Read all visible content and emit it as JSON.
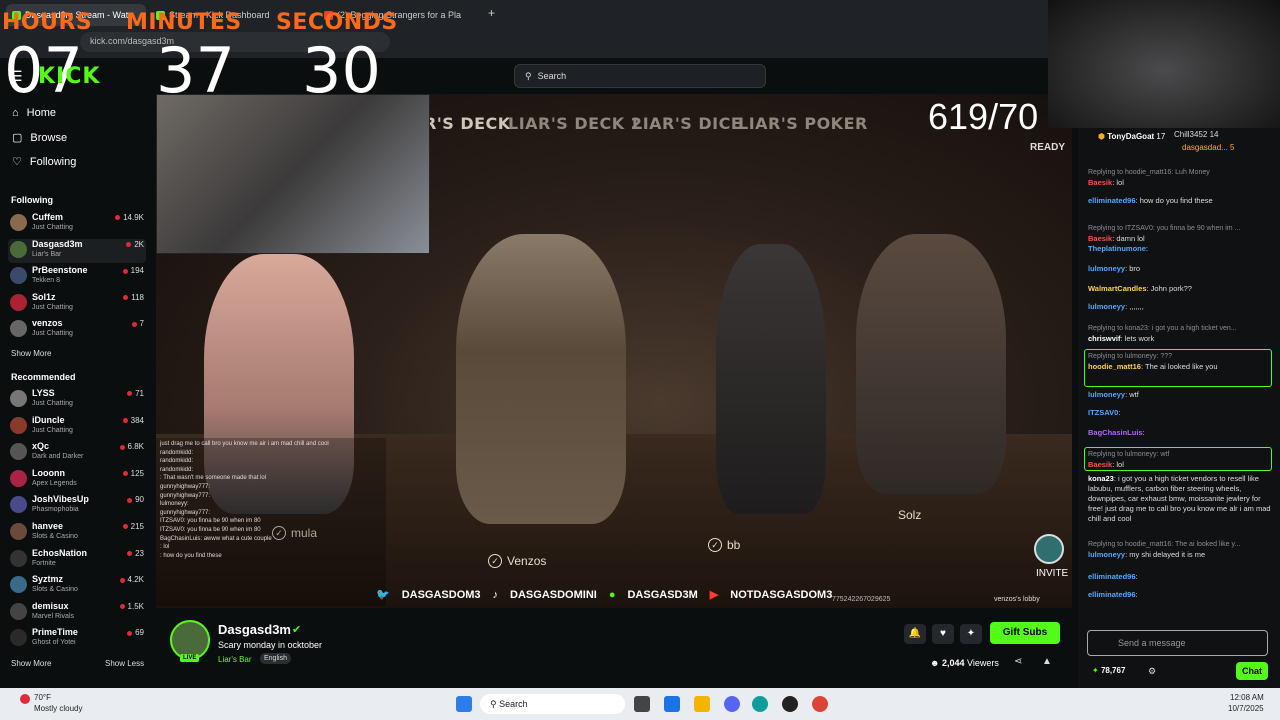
{
  "browser": {
    "tabs": [
      "Dasgasd3m Stream - Watc",
      "Stream - Kick Dashboard",
      "(2) Begging Strangers for a Pla"
    ],
    "url": "kick.com/dasgasd3m"
  },
  "timer": {
    "labels": [
      "HOURS",
      "MINUTES",
      "SECONDS"
    ],
    "values": [
      "07",
      "37",
      "30"
    ]
  },
  "logo": "KICK",
  "search": {
    "placeholder": "Search"
  },
  "nav": [
    "Home",
    "Browse",
    "Following"
  ],
  "following": {
    "title": "Following",
    "channels": [
      {
        "name": "Cuffem",
        "category": "Just Chatting",
        "viewers": "14.9K",
        "color": "#8a6a4a"
      },
      {
        "name": "Dasgasd3m",
        "category": "Liar's Bar",
        "viewers": "2K",
        "color": "#4b6a3a"
      },
      {
        "name": "PrBeenstone",
        "category": "Tekken 8",
        "viewers": "194",
        "color": "#3a4a6a"
      },
      {
        "name": "Sol1z",
        "category": "Just Chatting",
        "viewers": "118",
        "color": "#aa2233"
      },
      {
        "name": "venzos",
        "category": "Just Chatting",
        "viewers": "7",
        "color": "#666"
      }
    ],
    "show_more": "Show More"
  },
  "recommended": {
    "title": "Recommended",
    "channels": [
      {
        "name": "LYSS",
        "category": "Just Chatting",
        "viewers": "71",
        "color": "#777"
      },
      {
        "name": "iDuncle",
        "category": "Just Chatting",
        "viewers": "384",
        "color": "#8a3a2a"
      },
      {
        "name": "xQc",
        "category": "Dark and Darker",
        "viewers": "6.8K",
        "color": "#555"
      },
      {
        "name": "Looonn",
        "category": "Apex Legends",
        "viewers": "125",
        "color": "#aa2244"
      },
      {
        "name": "JoshVibesUp",
        "category": "Phasmophobia",
        "viewers": "90",
        "color": "#4a4a8a"
      },
      {
        "name": "hanvee",
        "category": "Slots & Casino",
        "viewers": "215",
        "color": "#6a4a3a"
      },
      {
        "name": "EchosNation",
        "category": "Fortnite",
        "viewers": "23",
        "color": "#333"
      },
      {
        "name": "Syztmz",
        "category": "Slots & Casino",
        "viewers": "4.2K",
        "color": "#3a6a8a"
      },
      {
        "name": "demisux",
        "category": "Marvel Rivals",
        "viewers": "1.5K",
        "color": "#444"
      },
      {
        "name": "PrimeTime",
        "category": "Ghost of Yotei",
        "viewers": "69",
        "color": "#2a2a2a"
      }
    ],
    "show_more": "Show More",
    "show_less": "Show Less"
  },
  "video": {
    "game_tabs": [
      "R'S DECK",
      "LIAR'S DECK 2",
      "LIAR'S DICE",
      "LIAR'S POKER"
    ],
    "counter": "619/70",
    "ready": "READY",
    "players": [
      "mula",
      "Venzos",
      "bb",
      "Solz"
    ],
    "invite": "INVITE",
    "socials": [
      "DASGASDOM3",
      "DASGASDOMINI",
      "DASGASD3M",
      "NOTDASGASDOM3"
    ],
    "lobby": "venzos's lobby",
    "code": "775242267029625",
    "game_chat": [
      "just drag me to call bro you know me air i am mad chill and cool",
      "randomkidd: ",
      "randomkidd: ",
      "randomkidd: ",
      ": That wasn't me someone made that lol",
      "gunnyhighway777: ",
      "gunnyhighway777: ",
      "lulmoneyy: ",
      "gunnyhighway777: ",
      "ITZSAV0: you finna be 90 when im 80",
      "ITZSAV0: you finna be 90 when im 80",
      "BagChasinLuis: awww what a cute couple",
      ": lol",
      ": how do you find these"
    ]
  },
  "stream_info": {
    "streamer": "Dasgasd3m",
    "title": "Scary monday in ocktober",
    "category": "Liar's Bar",
    "language": "English",
    "live": "LIVE",
    "viewers": "2,044",
    "viewers_label": "Viewers",
    "gift_subs": "Gift Subs"
  },
  "chat": {
    "top_gifters": [
      {
        "name": "TonyDaGoat",
        "count": "17"
      },
      {
        "name": "Chill3452",
        "count": "14"
      },
      {
        "name": "dasgasdad...",
        "count": "5"
      }
    ],
    "messages": [
      {
        "reply": "Replying to hoodie_matt16: Luh Money",
        "user": "Baesik",
        "text": "lol",
        "color": "#ff4d4d"
      },
      {
        "user": "elliminated96",
        "text": "how do you find these",
        "color": "#53a8ff"
      },
      {
        "reply": "Replying to ITZSAV0: you finna be 90 when im ...",
        "user": "Baesik",
        "text": "damn lol",
        "color": "#ff4d4d"
      },
      {
        "user": "Theplatinumone",
        "text": "",
        "color": "#53a8ff"
      },
      {
        "user": "lulmoneyy",
        "text": "bro",
        "color": "#53a8ff"
      },
      {
        "user": "WalmartCandles",
        "text": "John pork??",
        "color": "#ffd24d"
      },
      {
        "user": "lulmoneyy",
        "text": ",,,,,,,",
        "color": "#53a8ff"
      },
      {
        "reply": "Replying to kona23: i got you a high ticket ven...",
        "user": "chriswvif",
        "text": "lets work",
        "color": "#ffffff"
      },
      {
        "reply": "Replying to lulmoneyy: ???",
        "user": "hoodie_matt16",
        "text": "The ai looked like you",
        "color": "#ffd24d"
      },
      {
        "user": "lulmoneyy",
        "text": "wtf",
        "color": "#53a8ff"
      },
      {
        "user": "ITZSAV0",
        "text": "",
        "color": "#53a8ff"
      },
      {
        "user": "BagChasinLuis",
        "text": "",
        "color": "#b066ff"
      },
      {
        "reply": "Replying to lulmoneyy: wtf",
        "user": "Baesik",
        "text": "lol",
        "color": "#ff4d4d"
      },
      {
        "user": "kona23",
        "text": "i got you a high ticket vendors to resell like labubu, mufflers, carbon fiber steering wheels, downpipes, car exhaust bmw, moissanite jewlery for free! just drag me to call bro you know me alr i am mad chill and cool",
        "color": "#ffffff"
      },
      {
        "reply": "Replying to hoodie_matt16: The ai looked like y...",
        "user": "lulmoneyy",
        "text": "my shi delayed it is me",
        "color": "#53a8ff"
      },
      {
        "user": "elliminated96",
        "text": "",
        "color": "#53a8ff"
      },
      {
        "user": "elliminated96",
        "text": "",
        "color": "#53a8ff"
      }
    ],
    "input_placeholder": "Send a message",
    "points": "78,767",
    "chat_button": "Chat"
  },
  "taskbar": {
    "temp": "70°F",
    "weather": "Mostly cloudy",
    "search": "Search",
    "time": "12:08 AM",
    "date": "10/7/2025"
  },
  "colors": {
    "accent": "#53fc18",
    "timer_label": "#ff6a1a",
    "live_dot": "#e0293a"
  }
}
